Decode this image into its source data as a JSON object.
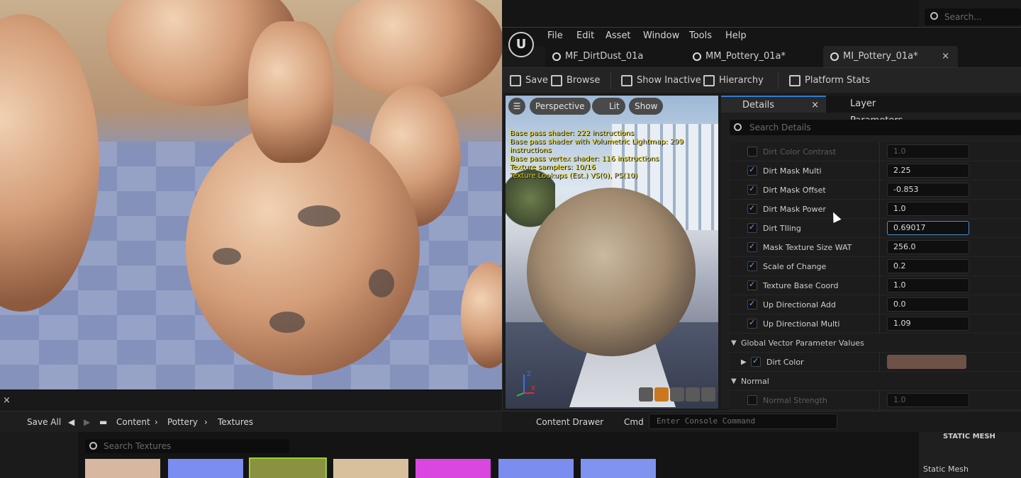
{
  "menu": [
    "File",
    "Edit",
    "Asset",
    "Window",
    "Tools",
    "Help"
  ],
  "tabs": [
    {
      "label": "MF_DirtDust_01a"
    },
    {
      "label": "MM_Pottery_01a*"
    },
    {
      "label": "MI_Pottery_01a*",
      "close": "×"
    }
  ],
  "toolbar": {
    "save": "Save",
    "browse": "Browse",
    "show_inactive": "Show Inactive",
    "hierarchy": "Hierarchy",
    "platform_stats": "Platform Stats"
  },
  "viewport": {
    "perspective": "Perspective",
    "lit": "Lit",
    "show": "Show",
    "stats": [
      "Base pass shader: 222 instructions",
      "Base pass shader with Volumetric Lightmap: 299 instructions",
      "Base pass vertex shader: 116 instructions",
      "Texture samplers: 10/16",
      "Texture Lookups (Est.) VS(0), PS(10)"
    ],
    "axis_z": "Z",
    "axis_x": "X"
  },
  "details": {
    "tab": "Details",
    "tab_close": "×",
    "layer_tab": "Layer Parameters",
    "search_placeholder": "Search Details",
    "params": [
      {
        "label": "Dirt Color Contrast",
        "value": "1.0",
        "checked": false,
        "dim": true
      },
      {
        "label": "Dirt Mask Multi",
        "value": "2.25",
        "checked": true
      },
      {
        "label": "Dirt Mask Offset",
        "value": "-0.853",
        "checked": true
      },
      {
        "label": "Dirt Mask Power",
        "value": "1.0",
        "checked": true
      },
      {
        "label": "Dirt TIling",
        "value": "0.69017",
        "checked": true,
        "focus": true
      },
      {
        "label": "Mask Texture Size WAT",
        "value": "256.0",
        "checked": true
      },
      {
        "label": "Scale of Change",
        "value": "0.2",
        "checked": true
      },
      {
        "label": "Texture Base Coord",
        "value": "1.0",
        "checked": true
      },
      {
        "label": "Up Directional Add",
        "value": "0.0",
        "checked": true
      },
      {
        "label": "Up Directional Multi",
        "value": "1.09",
        "checked": true
      }
    ],
    "section_vector": "Global Vector Parameter Values",
    "dirt_color": {
      "label": "Dirt Color",
      "color": "#6e5147"
    },
    "section_normal": "Normal",
    "normal_strength": {
      "label": "Normal Strength",
      "value": "1.0"
    }
  },
  "content_drawer": {
    "label": "Content Drawer",
    "cmd": "Cmd",
    "console_placeholder": "Enter Console Command"
  },
  "breadcrumb": {
    "save_all": "Save All",
    "items": [
      "Content",
      "Pottery",
      "Textures"
    ]
  },
  "texture_search": "Search Textures",
  "top_search": "Search...",
  "right_panel": {
    "section": "STATIC MESH",
    "label": "Static Mesh"
  },
  "thumbs": [
    "#d7b7a0",
    "#7b8df0",
    "#8a9140",
    "#d8c09c",
    "#d946e0",
    "#7b8ef0",
    "#7f93ef"
  ]
}
